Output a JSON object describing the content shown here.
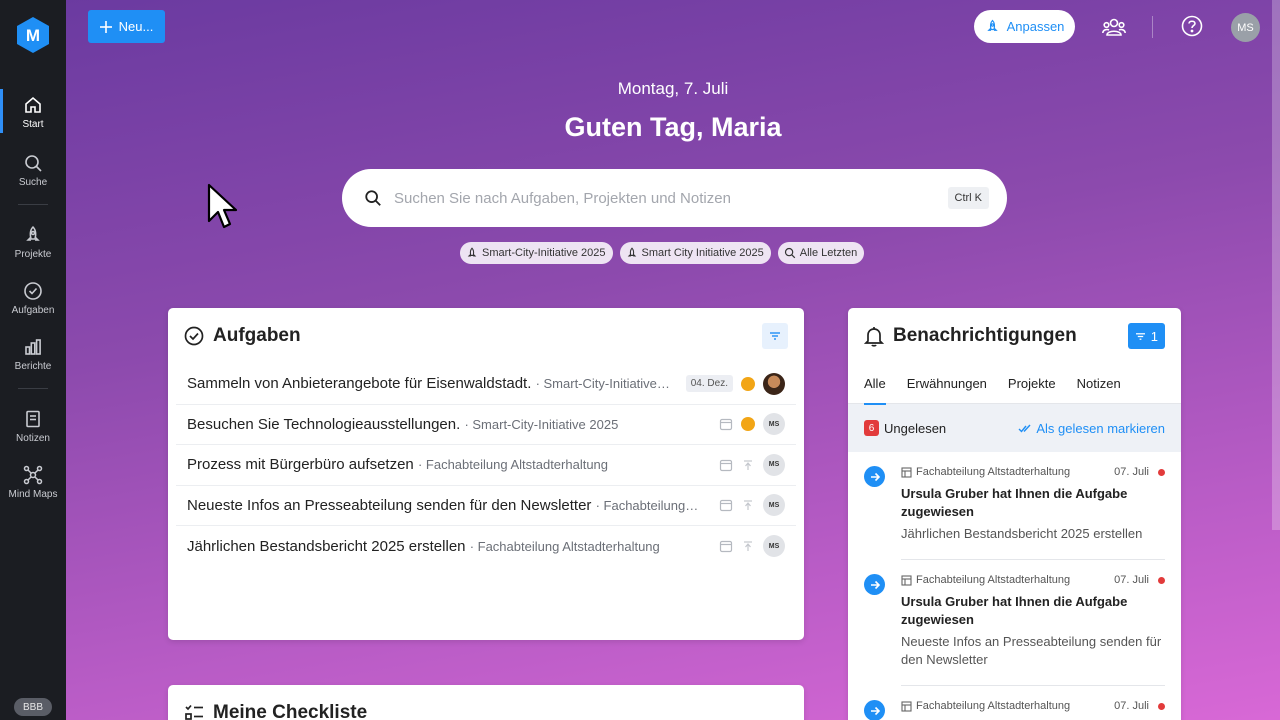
{
  "app": {
    "logo_letter": "M",
    "bottom_badge": "BBB"
  },
  "sidebar": {
    "items": [
      {
        "label": "Start",
        "icon": "home-icon"
      },
      {
        "label": "Suche",
        "icon": "search-icon"
      },
      {
        "label": "Projekte",
        "icon": "rocket-icon"
      },
      {
        "label": "Aufgaben",
        "icon": "check-circle-icon"
      },
      {
        "label": "Berichte",
        "icon": "bar-chart-icon"
      },
      {
        "label": "Notizen",
        "icon": "note-icon"
      },
      {
        "label": "Mind Maps",
        "icon": "mindmap-icon"
      }
    ]
  },
  "header": {
    "new_label": "Neu...",
    "customize_label": "Anpassen",
    "user_initials": "MS"
  },
  "hero": {
    "date": "Montag, 7. Juli",
    "greeting": "Guten Tag, Maria",
    "search_placeholder": "Suchen Sie nach Aufgaben, Projekten und Notizen",
    "search_shortcut": "Ctrl K",
    "chips": [
      "Smart-City-Initiative 2025",
      "Smart City Initiative 2025",
      "Alle Letzten"
    ]
  },
  "tasks": {
    "title": "Aufgaben",
    "rows": [
      {
        "name": "Sammeln von Anbieterangebote für Eisenwaldstadt.",
        "project": "· Smart-City-Initiative…",
        "due": "04. Dez.",
        "assignee": ""
      },
      {
        "name": "Besuchen Sie Technologieausstellungen.",
        "project": "· Smart-City-Initiative 2025",
        "due": "",
        "assignee": "MS"
      },
      {
        "name": "Prozess mit Bürgerbüro aufsetzen",
        "project": "· Fachabteilung Altstadterhaltung",
        "due": "",
        "assignee": "MS"
      },
      {
        "name": "Neueste Infos an Presseabteilung senden für den Newsletter",
        "project": "· Fachabteilung…",
        "due": "",
        "assignee": "MS"
      },
      {
        "name": "Jährlichen Bestandsbericht 2025 erstellen",
        "project": "· Fachabteilung Altstadterhaltung",
        "due": "",
        "assignee": "MS"
      }
    ]
  },
  "checklist": {
    "title": "Meine Checkliste"
  },
  "notifications": {
    "title": "Benachrichtigungen",
    "filter_count": "1",
    "tabs": [
      "Alle",
      "Erwähnungen",
      "Projekte",
      "Notizen"
    ],
    "unread_count": "6",
    "unread_label": "Ungelesen",
    "mark_read_label": "Als gelesen markieren",
    "items": [
      {
        "project": "Fachabteilung Altstadterhaltung",
        "date": "07. Juli",
        "title": "Ursula Gruber hat Ihnen die Aufgabe zugewiesen",
        "desc": "Jährlichen Bestandsbericht 2025 erstellen"
      },
      {
        "project": "Fachabteilung Altstadterhaltung",
        "date": "07. Juli",
        "title": "Ursula Gruber hat Ihnen die Aufgabe zugewiesen",
        "desc": "Neueste Infos an Presseabteilung senden für den Newsletter"
      },
      {
        "project": "Fachabteilung Altstadterhaltung",
        "date": "07. Juli",
        "title": "",
        "desc": ""
      }
    ]
  },
  "colors": {
    "accent": "#1f8ff5",
    "sidebar": "#1b1d22",
    "priority_high": "#f2a516",
    "unread": "#e23b3b"
  }
}
